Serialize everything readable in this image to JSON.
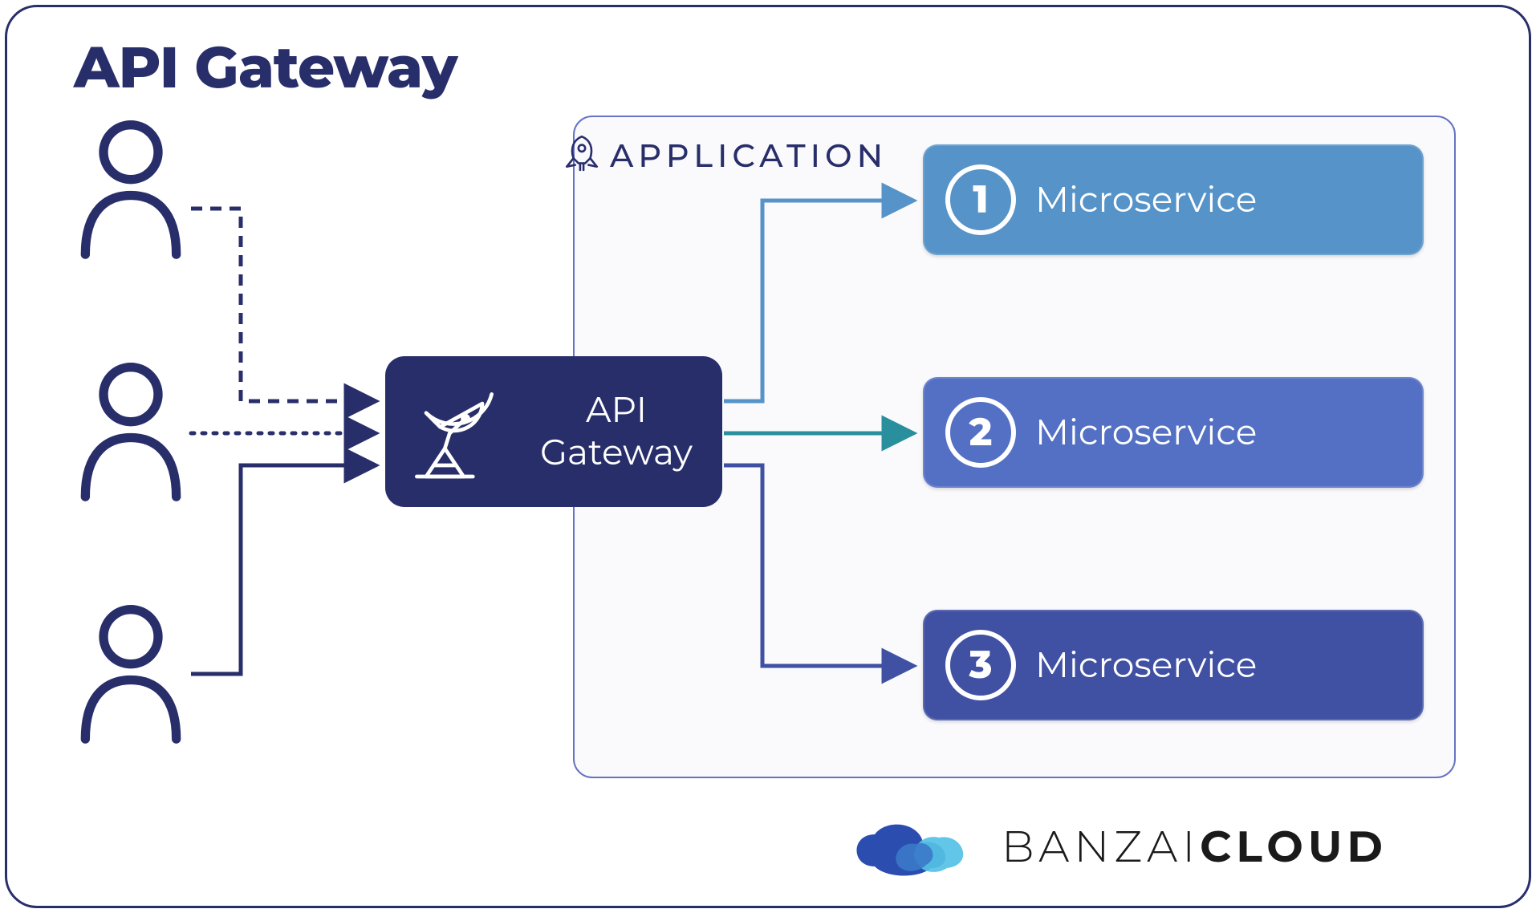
{
  "title": "API Gateway",
  "application_label": "APPLICATION",
  "gateway": {
    "label_line1": "API",
    "label_line2": "Gateway"
  },
  "microservices": [
    {
      "num": "1",
      "label": "Microservice"
    },
    {
      "num": "2",
      "label": "Microservice"
    },
    {
      "num": "3",
      "label": "Microservice"
    }
  ],
  "brand": {
    "part1": "BANZAI",
    "part2": "CLOUD"
  },
  "colors": {
    "navy": "#282e6a",
    "ms1": "#5593c8",
    "ms2": "#5470c4",
    "ms3": "#4051a3",
    "teal": "#2a8f9c"
  }
}
